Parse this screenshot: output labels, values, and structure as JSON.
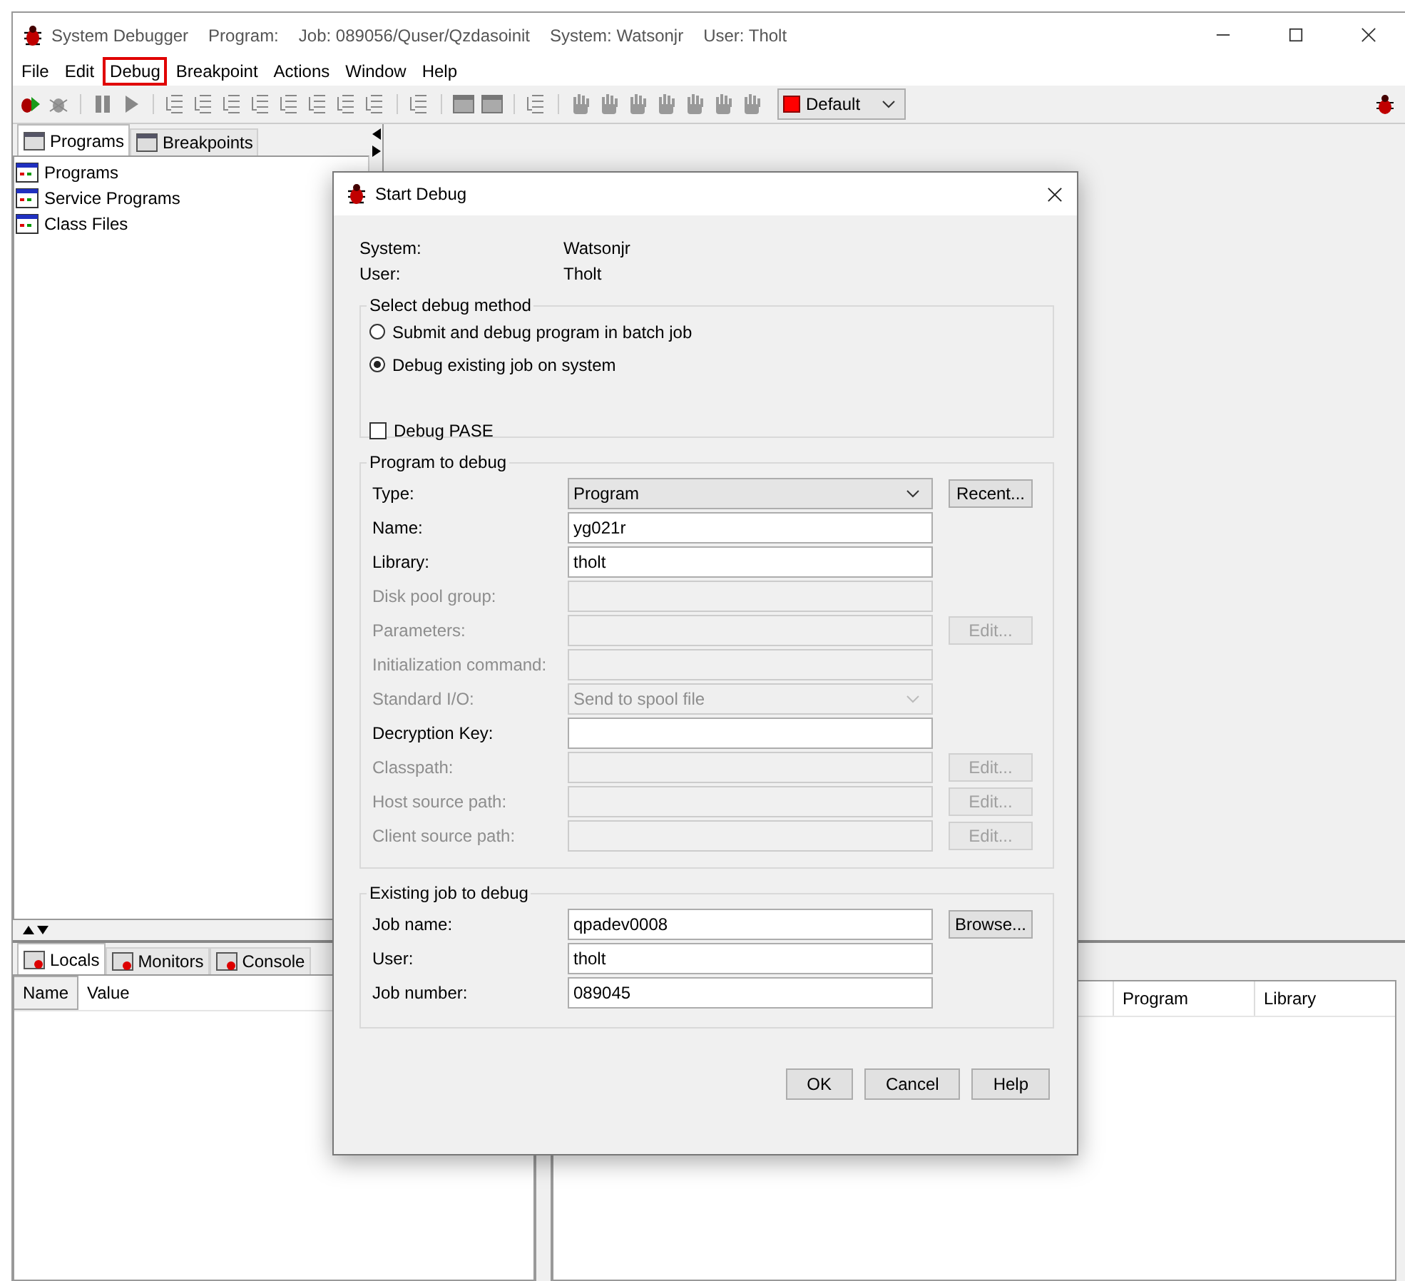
{
  "window": {
    "title_parts": [
      "System Debugger",
      "Program:",
      "Job: 089056/Quser/Qzdasoinit",
      "System: Watsonjr",
      "User: Tholt"
    ]
  },
  "menu": [
    {
      "label": "File",
      "highlighted": false
    },
    {
      "label": "Edit",
      "highlighted": false
    },
    {
      "label": "Debug",
      "highlighted": true
    },
    {
      "label": "Breakpoint",
      "highlighted": false
    },
    {
      "label": "Actions",
      "highlighted": false
    },
    {
      "label": "Window",
      "highlighted": false
    },
    {
      "label": "Help",
      "highlighted": false
    }
  ],
  "toolbar": {
    "view_combo": {
      "value": "Default",
      "color": "#ff0000"
    }
  },
  "left_tabs": [
    {
      "label": "Programs",
      "selected": true
    },
    {
      "label": "Breakpoints",
      "selected": false
    }
  ],
  "tree": [
    {
      "label": "Programs"
    },
    {
      "label": "Service Programs"
    },
    {
      "label": "Class Files"
    }
  ],
  "bottom_tabs": [
    {
      "label": "Locals",
      "selected": true
    },
    {
      "label": "Monitors",
      "selected": false
    },
    {
      "label": "Console",
      "selected": false
    }
  ],
  "locals_table": {
    "columns": [
      "Name",
      "Value"
    ]
  },
  "stack_table": {
    "columns": [
      "Program",
      "Library"
    ]
  },
  "dialog": {
    "title": "Start Debug",
    "info": [
      {
        "label": "System:",
        "value": "Watsonjr"
      },
      {
        "label": "User:",
        "value": "Tholt"
      }
    ],
    "method_group": {
      "title": "Select debug method",
      "options": [
        {
          "label": "Submit and debug program in batch job",
          "selected": false
        },
        {
          "label": "Debug existing job on system",
          "selected": true
        }
      ],
      "pase": {
        "label": "Debug PASE",
        "checked": false
      }
    },
    "program_group": {
      "title": "Program to debug",
      "fields": [
        {
          "label": "Type:",
          "kind": "combo",
          "value": "Program",
          "disabled": false,
          "button": {
            "label": "Recent...",
            "disabled": false
          }
        },
        {
          "label": "Name:",
          "kind": "text",
          "value": "yg021r",
          "disabled": false
        },
        {
          "label": "Library:",
          "kind": "text",
          "value": "tholt",
          "disabled": false
        },
        {
          "label": "Disk pool group:",
          "kind": "text",
          "disabled": true
        },
        {
          "label": "Parameters:",
          "kind": "text",
          "disabled": true,
          "button": {
            "label": "Edit...",
            "disabled": true
          }
        },
        {
          "label": "Initialization command:",
          "kind": "text",
          "disabled": true
        },
        {
          "label": "Standard I/O:",
          "kind": "combo",
          "value": "Send to spool file",
          "disabled": true
        },
        {
          "label": "Decryption Key:",
          "kind": "text",
          "disabled": false
        },
        {
          "label": "Classpath:",
          "kind": "text",
          "disabled": true,
          "button": {
            "label": "Edit...",
            "disabled": true
          }
        },
        {
          "label": "Host source path:",
          "kind": "text",
          "disabled": true,
          "button": {
            "label": "Edit...",
            "disabled": true
          }
        },
        {
          "label": "Client source path:",
          "kind": "text",
          "disabled": true,
          "button": {
            "label": "Edit...",
            "disabled": true
          }
        }
      ]
    },
    "job_group": {
      "title": "Existing job to debug",
      "fields": [
        {
          "label": "Job name:",
          "kind": "text",
          "value": "qpadev0008",
          "disabled": false,
          "button": {
            "label": "Browse...",
            "disabled": false
          }
        },
        {
          "label": "User:",
          "kind": "text",
          "value": "tholt",
          "disabled": false
        },
        {
          "label": "Job number:",
          "kind": "text",
          "value": "089045",
          "disabled": false
        }
      ]
    },
    "buttons": [
      "OK",
      "Cancel",
      "Help"
    ]
  }
}
